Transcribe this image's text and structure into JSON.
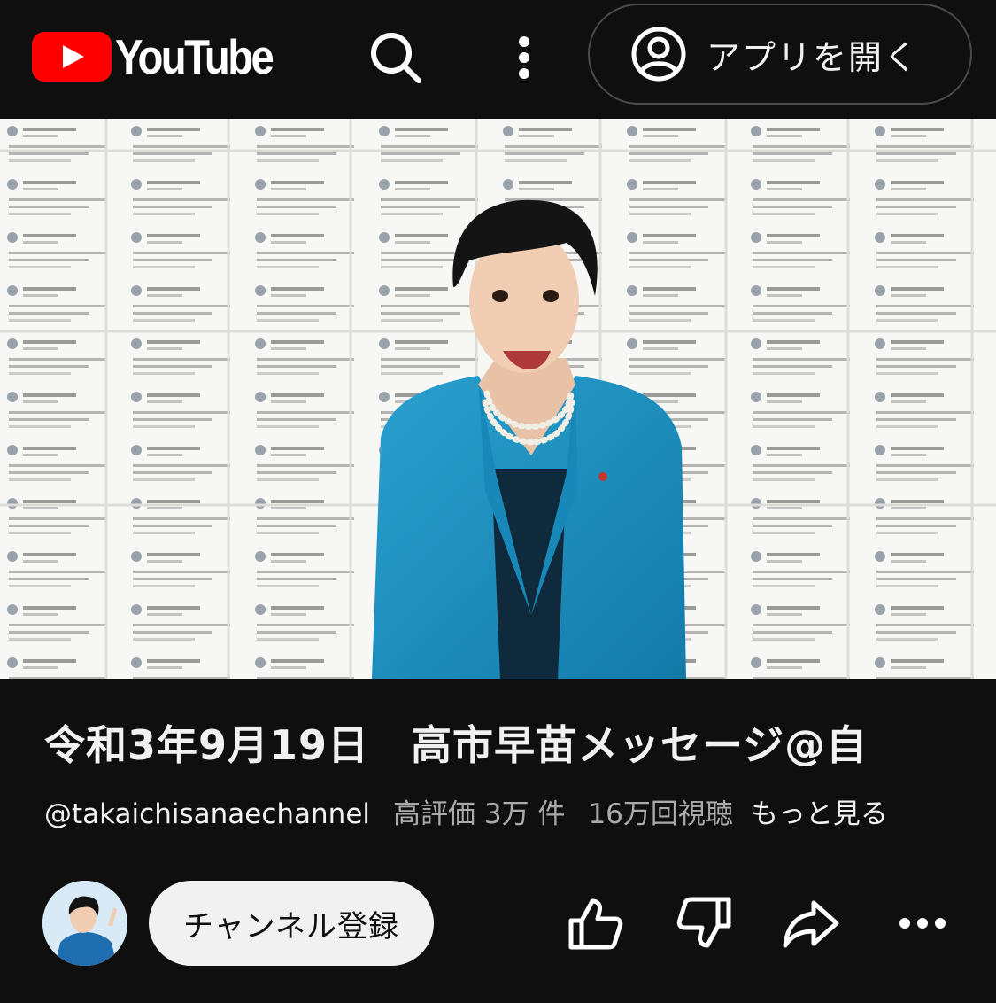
{
  "topbar": {
    "logo_text": "YouTube",
    "open_app_label": "アプリを開く",
    "icons": [
      "youtube-logo-icon",
      "search-icon",
      "more-vert-icon",
      "account-circle-icon"
    ]
  },
  "video": {
    "title": "令和3年9月19日　高市早苗メッセージ@自",
    "channel_handle": "@takaichisanaechannel",
    "likes_text": "高評価 3万 件",
    "views_text": "16万回視聴",
    "more_label": "もっと見る"
  },
  "actions": {
    "subscribe_label": "チャンネル登録",
    "icons": [
      "like-icon",
      "dislike-icon",
      "share-icon",
      "more-horiz-icon"
    ]
  },
  "colors": {
    "background": "#0f0f0f",
    "youtube_red": "#ff0000",
    "text_primary": "#f1f1f1",
    "text_secondary": "#aaaaaa",
    "jacket_blue": "#1f8fbf"
  }
}
